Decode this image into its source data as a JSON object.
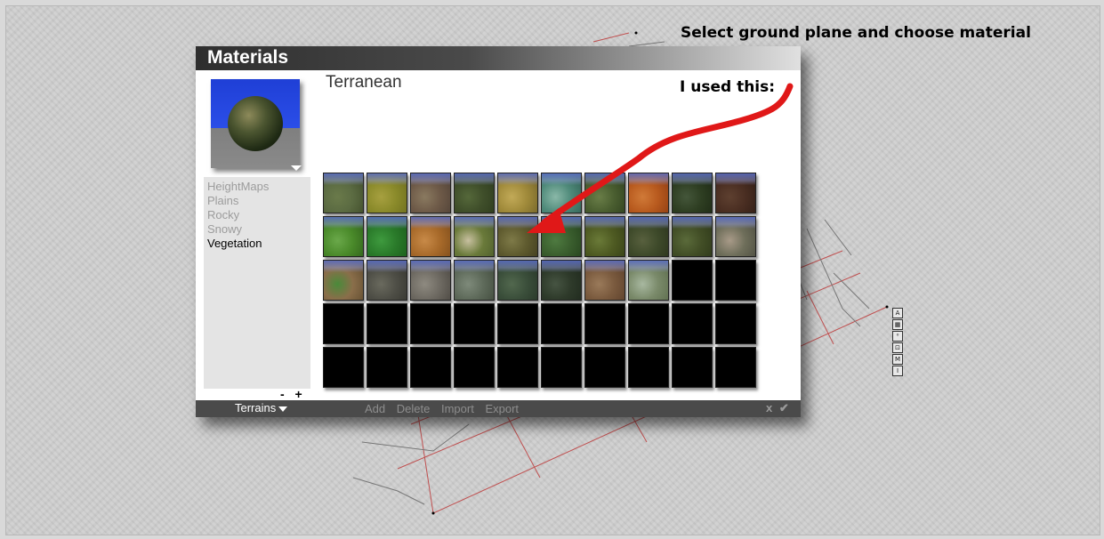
{
  "caption": "Select ground plane and choose material",
  "annotation": "I used this:",
  "mini_toolbar": [
    "A",
    "▦",
    "⁰",
    "⊡",
    "M",
    "I"
  ],
  "window": {
    "title": "Materials",
    "material_name": "Terranean",
    "categories": [
      {
        "label": "HeightMaps",
        "active": false
      },
      {
        "label": "Plains",
        "active": false
      },
      {
        "label": "Rocky",
        "active": false
      },
      {
        "label": "Snowy",
        "active": false
      },
      {
        "label": "Vegetation",
        "active": true
      }
    ],
    "list_buttons": "- +",
    "library_dropdown": "Terrains",
    "actions": [
      "Add",
      "Delete",
      "Import",
      "Export"
    ],
    "cancel_icon": "x",
    "ok_icon": "✔",
    "swatch_rows": 5,
    "swatch_cols": 10,
    "swatches": [
      [
        "#5b6b42",
        "#3e4a28",
        "#6a7a4a"
      ],
      [
        "#8a8a2a",
        "#6b6b1e",
        "#a7a040"
      ],
      [
        "#6e5a48",
        "#4e4036",
        "#8a7a60"
      ],
      [
        "#3f4e2a",
        "#2c3a1c",
        "#55683a"
      ],
      [
        "#a08a3a",
        "#6e6028",
        "#c2aa58"
      ],
      [
        "#4f8a7a",
        "#2f5e52",
        "#8ab8a8"
      ],
      [
        "#4a5e30",
        "#2e3e1e",
        "#6a7e48"
      ],
      [
        "#b85a1e",
        "#8a3a12",
        "#d07a38"
      ],
      [
        "#2e3e22",
        "#1c2814",
        "#44563a"
      ],
      [
        "#4a2e22",
        "#2e1c14",
        "#5e4030"
      ],
      [
        "#4a8a2a",
        "#2e5e1a",
        "#6aa84a"
      ],
      [
        "#2a7a2a",
        "#1a5a1a",
        "#3e9a3e"
      ],
      [
        "#a86a2a",
        "#7a4a1a",
        "#c88a48"
      ],
      [
        "#6a7a3a",
        "#4a5a2a",
        "#c8c0a0"
      ],
      [
        "#5e5a2e",
        "#3e3a1e",
        "#7e7a48"
      ],
      [
        "#3a5e2e",
        "#24401c",
        "#4e7a40"
      ],
      [
        "#4e5a22",
        "#343e16",
        "#6a7a38"
      ],
      [
        "#3e4a2a",
        "#2a321c",
        "#58603e"
      ],
      [
        "#424e26",
        "#2c3618",
        "#5a6a3a"
      ],
      [
        "#6e6e5a",
        "#4a4a3e",
        "#a89a88"
      ],
      [
        "#8a6e4a",
        "#5e4a2e",
        "#4a8a3a"
      ],
      [
        "#4e4e46",
        "#34342e",
        "#6a6a5e"
      ],
      [
        "#6e6a62",
        "#48443e",
        "#8e8a80"
      ],
      [
        "#5e6a5a",
        "#3e483a",
        "#7e8a7a"
      ],
      [
        "#3a4e3a",
        "#263426",
        "#52684e"
      ],
      [
        "#2e3a2a",
        "#1e281c",
        "#465442"
      ],
      [
        "#7a5a3e",
        "#5a3e2a",
        "#9a7a5a"
      ],
      [
        "#7a8a6a",
        "#5a6a4a",
        "#a8b8a0"
      ]
    ]
  }
}
